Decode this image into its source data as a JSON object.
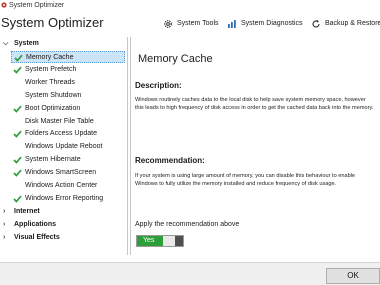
{
  "window": {
    "title": "System Optimizer"
  },
  "header": {
    "app_name": "System Optimizer"
  },
  "toolbar": {
    "tools_label": "System Tools",
    "diagnostics_label": "System Diagnostics",
    "backup_label": "Backup & Restore"
  },
  "sidebar": {
    "system_label": "System",
    "system_items": [
      {
        "label": "Memory Cache",
        "checked": true,
        "selected": true
      },
      {
        "label": "System Prefetch",
        "checked": true,
        "selected": false
      },
      {
        "label": "Worker Threads",
        "checked": false,
        "selected": false
      },
      {
        "label": "System Shutdown",
        "checked": false,
        "selected": false
      },
      {
        "label": "Boot Optimization",
        "checked": true,
        "selected": false
      },
      {
        "label": "Disk Master File Table",
        "checked": false,
        "selected": false
      },
      {
        "label": "Folders Access Update",
        "checked": true,
        "selected": false
      },
      {
        "label": "Windows Update Reboot",
        "checked": false,
        "selected": false
      },
      {
        "label": "System Hibernate",
        "checked": true,
        "selected": false
      },
      {
        "label": "Windows SmartScreen",
        "checked": true,
        "selected": false
      },
      {
        "label": "Windows Action Center",
        "checked": false,
        "selected": false
      },
      {
        "label": "Windows Error Reporting",
        "checked": true,
        "selected": false
      }
    ],
    "internet_label": "Internet",
    "applications_label": "Applications",
    "visual_effects_label": "Visual Effects"
  },
  "content": {
    "title": "Memory Cache",
    "description_heading": "Description:",
    "description_text": "Windows routinely caches data to the local disk to help save system memory space, however this leads to high frequency of disk access in order to get the cached data back into the memory.",
    "recommendation_heading": "Recommendation:",
    "recommendation_text": "If your system is using large amount of memory, you can disable this behaviour to enable Windows to fully utilize the memory installed and reduce frequency of disk usage.",
    "apply_label": "Apply the recommendation above",
    "toggle_label": "Yes",
    "toggle_on": true
  },
  "footer": {
    "ok_label": "OK"
  },
  "colors": {
    "check": "#2e9e3b",
    "toggle_on": "#2e9e3b",
    "selection": "#cce4f7"
  }
}
